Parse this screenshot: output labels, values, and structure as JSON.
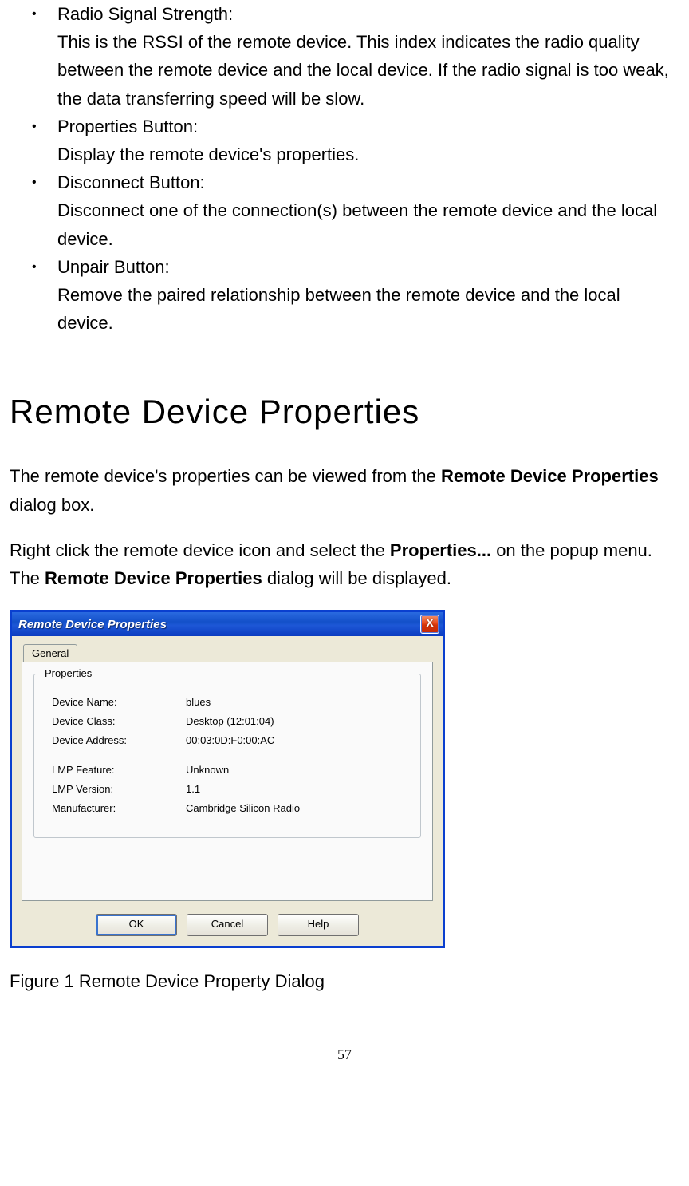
{
  "bullets": [
    {
      "title": "Radio Signal Strength:",
      "desc": "This is the RSSI of the remote device. This index indicates the radio quality between the remote device and the local device. If the radio signal is too weak, the data transferring speed will be slow."
    },
    {
      "title": "Properties Button:",
      "desc": "Display the remote device's properties."
    },
    {
      "title": "Disconnect Button:",
      "desc": "Disconnect one of the connection(s) between the remote device and the local device."
    },
    {
      "title": "Unpair Button:",
      "desc": "Remove the paired relationship between the remote device and the local device."
    }
  ],
  "heading": "Remote Device Properties",
  "para1_a": "The remote device's properties can be viewed from the ",
  "para1_b": "Remote Device Properties",
  "para1_c": " dialog box.",
  "para2_a": "Right click the remote device icon and select the ",
  "para2_b": "Properties...",
  "para2_c": " on the popup menu. The ",
  "para2_d": "Remote Device Properties",
  "para2_e": " dialog will be displayed.",
  "dialog": {
    "title": "Remote Device Properties",
    "close": "X",
    "tab": "General",
    "legend": "Properties",
    "rows": [
      {
        "label": "Device Name:",
        "value": "blues"
      },
      {
        "label": "Device Class:",
        "value": "Desktop (12:01:04)"
      },
      {
        "label": "Device Address:",
        "value": "00:03:0D:F0:00:AC"
      },
      {
        "label": "LMP Feature:",
        "value": "Unknown",
        "spacer": true
      },
      {
        "label": "LMP Version:",
        "value": "1.1"
      },
      {
        "label": "Manufacturer:",
        "value": "Cambridge Silicon Radio"
      }
    ],
    "buttons": {
      "ok": "OK",
      "cancel": "Cancel",
      "help": "Help"
    }
  },
  "caption": "Figure 1 Remote Device Property Dialog",
  "page_num": "57"
}
